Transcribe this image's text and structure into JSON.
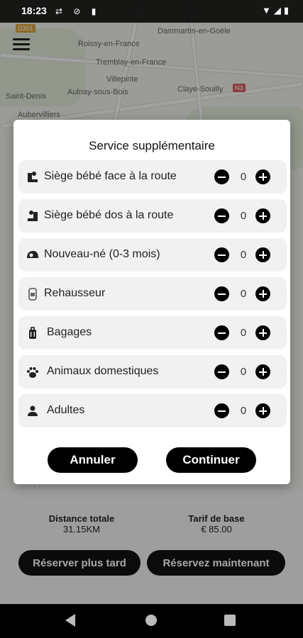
{
  "status_bar": {
    "time": "18:23"
  },
  "map": {
    "labels": [
      "Dammartin-en-Goële",
      "Roissy-en-France",
      "Tremblay-en-France",
      "Villepinte",
      "Saint-Denis",
      "Aulnay-sous-Bois",
      "Claye-Souilly",
      "Aubervilliers"
    ],
    "shields": [
      "D301",
      "N3"
    ]
  },
  "modal": {
    "title": "Service supplémentaire",
    "services": [
      {
        "label": "Siège bébé face à la route",
        "count": "0",
        "icon": "baby-seat-forward-icon"
      },
      {
        "label": "Siège bébé dos à la route",
        "count": "0",
        "icon": "baby-seat-rear-icon"
      },
      {
        "label": "Nouveau-né (0-3 mois)",
        "count": "0",
        "icon": "newborn-icon"
      },
      {
        "label": "Rehausseur",
        "count": "0",
        "icon": "booster-seat-icon"
      },
      {
        "label": "Bagages",
        "count": "0",
        "icon": "luggage-icon"
      },
      {
        "label": "Animaux domestiques",
        "count": "0",
        "icon": "paw-icon"
      },
      {
        "label": "Adultes",
        "count": "0",
        "icon": "person-icon"
      }
    ],
    "cancel_label": "Annuler",
    "continue_label": "Continuer"
  },
  "trip": {
    "distance_label": "Distance totale",
    "distance_value": "31.15KM",
    "fare_label": "Tarif de base",
    "fare_value": "€ 85.00"
  },
  "actions": {
    "later_label": "Réserver plus tard",
    "now_label": "Réservez maintenant"
  },
  "colors": {
    "accent": "#000000",
    "row_bg": "#f1f1f1",
    "modal_bg": "#ffffff"
  }
}
